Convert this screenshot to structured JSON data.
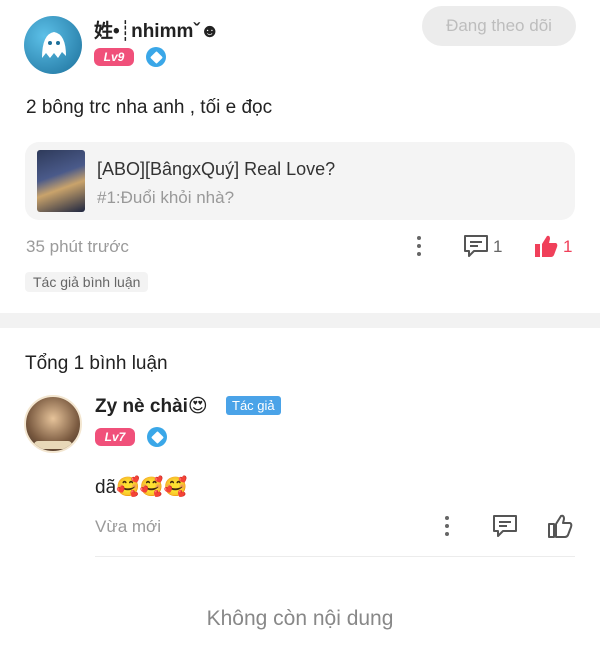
{
  "post": {
    "username": "姓•┊nhimmˇ☻",
    "level_badge": "Lv9",
    "follow_button": "Đang theo dõi",
    "content": "2 bông trc nha anh , tối e đọc",
    "story_card": {
      "title": "[ABO][BângxQuý] Real Love?",
      "chapter": "#1:Đuổi khỏi nhà?"
    },
    "timestamp": "35 phút trước",
    "comment_count": "1",
    "like_count": "1",
    "author_commented_tag": "Tác giả bình luận",
    "accent_color": "#f0405a"
  },
  "comments_section": {
    "total_label": "Tổng 1 bình luận",
    "comments": [
      {
        "username": "Zy nè chài😍",
        "author_tag": "Tác giả",
        "level_badge": "Lv7",
        "text": "dã🥰🥰🥰",
        "timestamp": "Vừa mới"
      }
    ]
  },
  "end_message": "Không còn nội dung"
}
